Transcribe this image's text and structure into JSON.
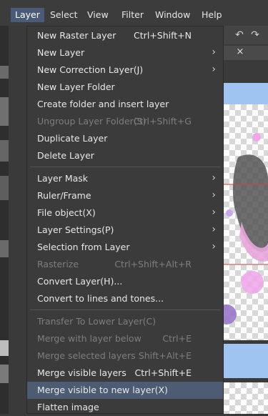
{
  "menubar": [
    {
      "label": "Layer",
      "active": true
    },
    {
      "label": "Select"
    },
    {
      "label": "View"
    },
    {
      "label": "Filter"
    },
    {
      "label": "Window"
    },
    {
      "label": "Help"
    }
  ],
  "side_text": {
    "close": "×"
  },
  "menu": {
    "items": [
      {
        "label": "New Raster Layer",
        "shortcut": "Ctrl+Shift+N"
      },
      {
        "label": "New Layer",
        "submenu": true
      },
      {
        "label": "New Correction Layer(J)",
        "submenu": true
      },
      {
        "label": "New Layer Folder"
      },
      {
        "label": "Create folder and insert layer"
      },
      {
        "label": "Ungroup Layer Folder(S)",
        "shortcut": "Ctrl+Shift+G",
        "disabled": true
      },
      {
        "label": "Duplicate Layer"
      },
      {
        "label": "Delete Layer"
      },
      {
        "label": "Layer Mask",
        "submenu": true
      },
      {
        "label": "Ruler/Frame",
        "submenu": true
      },
      {
        "label": "File object(X)",
        "submenu": true
      },
      {
        "label": "Layer Settings(P)",
        "submenu": true
      },
      {
        "label": "Selection from Layer",
        "submenu": true
      },
      {
        "label": "Rasterize",
        "shortcut": "Ctrl+Shift+Alt+R",
        "disabled": true
      },
      {
        "label": "Convert Layer(H)..."
      },
      {
        "label": "Convert to lines and tones..."
      },
      {
        "label": "Transfer To Lower Layer(C)",
        "disabled": true
      },
      {
        "label": "Merge with layer below",
        "shortcut": "Ctrl+E",
        "disabled": true
      },
      {
        "label": "Merge selected layers",
        "shortcut": "Shift+Alt+E",
        "disabled": true
      },
      {
        "label": "Merge visible layers",
        "shortcut": "Ctrl+Shift+E"
      },
      {
        "label": "Merge visible to new layer(X)",
        "highlighted": true
      },
      {
        "label": "Flatten image"
      }
    ]
  }
}
